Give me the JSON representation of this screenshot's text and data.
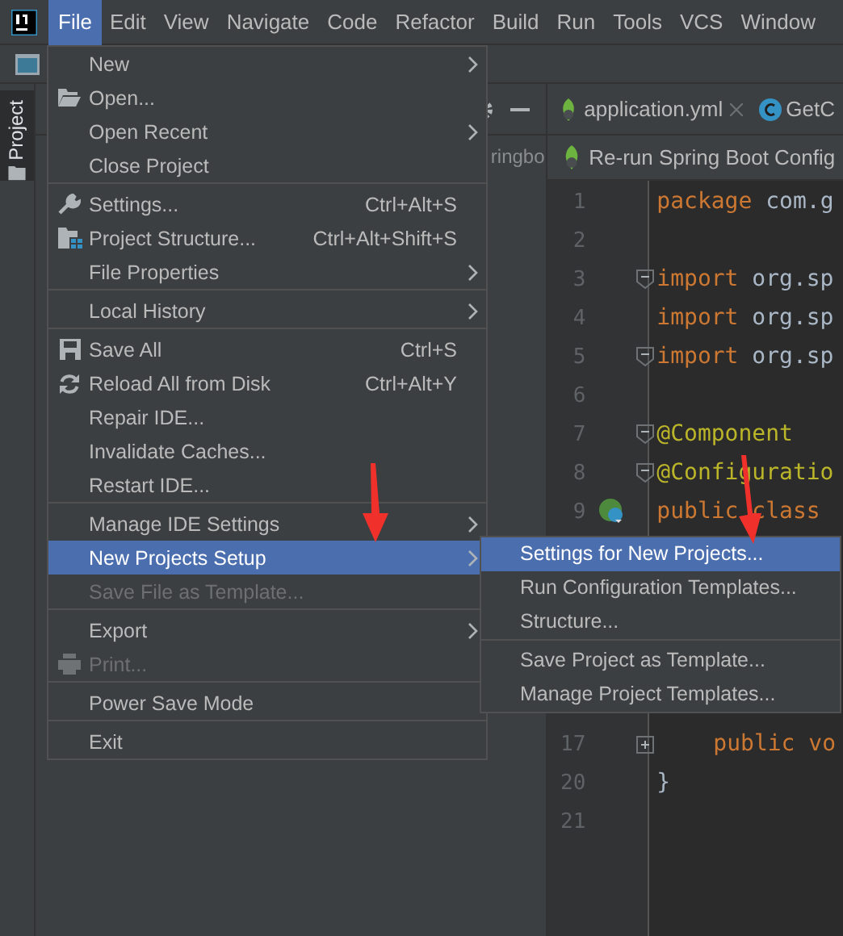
{
  "menubar": [
    {
      "label": "File",
      "selected": true
    },
    {
      "label": "Edit",
      "selected": false
    },
    {
      "label": "View",
      "selected": false
    },
    {
      "label": "Navigate",
      "selected": false
    },
    {
      "label": "Code",
      "selected": false
    },
    {
      "label": "Refactor",
      "selected": false
    },
    {
      "label": "Build",
      "selected": false
    },
    {
      "label": "Run",
      "selected": false
    },
    {
      "label": "Tools",
      "selected": false
    },
    {
      "label": "VCS",
      "selected": false
    },
    {
      "label": "Window",
      "selected": false
    }
  ],
  "tool_stripe": {
    "tab": {
      "label": "Project",
      "selected": true
    }
  },
  "project_panel": {
    "text": "ringbo"
  },
  "editor": {
    "tabs": [
      {
        "label": "application.yml",
        "kind": "yaml",
        "selected": true
      },
      {
        "label": "GetC",
        "kind": "class",
        "selected": false
      }
    ],
    "notification": "Re-run Spring Boot Config",
    "code_sections": [
      [
        {
          "number": "1",
          "indented": false,
          "tokens": [
            {
              "kind": "keyword",
              "text": "package"
            },
            {
              "kind": "plain",
              "text": " com.g"
            }
          ]
        },
        {
          "number": "2"
        },
        {
          "number": "3",
          "indented": false,
          "fold_marker": true,
          "collapsed": false,
          "tokens": [
            {
              "kind": "keyword",
              "text": "import"
            },
            {
              "kind": "plain",
              "text": " org.sp"
            }
          ]
        },
        {
          "number": "4",
          "indented": false,
          "tokens": [
            {
              "kind": "keyword",
              "text": "import"
            },
            {
              "kind": "plain",
              "text": " org.sp"
            }
          ]
        },
        {
          "number": "5",
          "indented": false,
          "fold_marker": true,
          "collapsed": false,
          "tokens": [
            {
              "kind": "keyword",
              "text": "import"
            },
            {
              "kind": "plain",
              "text": " org.sp"
            }
          ]
        },
        {
          "number": "6"
        },
        {
          "number": "7",
          "indented": false,
          "fold_marker": true,
          "collapsed": false,
          "tokens": [
            {
              "kind": "annotation",
              "text": "@Component"
            }
          ]
        },
        {
          "number": "8",
          "indented": false,
          "fold_marker": true,
          "collapsed": false,
          "tokens": [
            {
              "kind": "annotation",
              "text": "@Configuratio"
            }
          ]
        },
        {
          "number": "9",
          "indented": false,
          "bean_marker": true,
          "tokens": [
            {
              "kind": "keyword",
              "text": "public class"
            }
          ]
        }
      ],
      [
        {
          "number": "17",
          "indented": true,
          "fold_marker": true,
          "collapsed": true,
          "tokens": [
            {
              "kind": "keyword",
              "text": "public vo"
            }
          ]
        },
        {
          "number": "20",
          "indented": false,
          "tokens": [
            {
              "kind": "plain",
              "text": "}"
            }
          ]
        },
        {
          "number": "21"
        }
      ]
    ]
  },
  "file_menu": {
    "groups": [
      [
        {
          "label": "New",
          "submenu": true,
          "disabled": false,
          "selected": false
        },
        {
          "label": "Open...",
          "submenu": false,
          "disabled": false,
          "selected": false
        },
        {
          "label": "Open Recent",
          "submenu": true,
          "disabled": false,
          "selected": false
        },
        {
          "label": "Close Project",
          "submenu": false,
          "disabled": false,
          "selected": false
        }
      ],
      [
        {
          "label": "Settings...",
          "shortcut": "Ctrl+Alt+S",
          "submenu": false,
          "disabled": false,
          "selected": false
        },
        {
          "label": "Project Structure...",
          "shortcut": "Ctrl+Alt+Shift+S",
          "submenu": false,
          "disabled": false,
          "selected": false
        },
        {
          "label": "File Properties",
          "submenu": true,
          "disabled": false,
          "selected": false
        }
      ],
      [
        {
          "label": "Local History",
          "submenu": true,
          "disabled": false,
          "selected": false
        }
      ],
      [
        {
          "label": "Save All",
          "shortcut": "Ctrl+S",
          "submenu": false,
          "disabled": false,
          "selected": false
        },
        {
          "label": "Reload All from Disk",
          "shortcut": "Ctrl+Alt+Y",
          "submenu": false,
          "disabled": false,
          "selected": false
        },
        {
          "label": "Repair IDE...",
          "submenu": false,
          "disabled": false,
          "selected": false
        },
        {
          "label": "Invalidate Caches...",
          "submenu": false,
          "disabled": false,
          "selected": false
        },
        {
          "label": "Restart IDE...",
          "submenu": false,
          "disabled": false,
          "selected": false
        }
      ],
      [
        {
          "label": "Manage IDE Settings",
          "submenu": true,
          "disabled": false,
          "selected": false
        },
        {
          "label": "New Projects Setup",
          "submenu": true,
          "disabled": false,
          "selected": true
        },
        {
          "label": "Save File as Template...",
          "submenu": false,
          "disabled": true,
          "selected": false
        }
      ],
      [
        {
          "label": "Export",
          "submenu": true,
          "disabled": false,
          "selected": false
        },
        {
          "label": "Print...",
          "submenu": false,
          "disabled": true,
          "selected": false
        }
      ],
      [
        {
          "label": "Power Save Mode",
          "submenu": false,
          "disabled": false,
          "selected": false
        }
      ],
      [
        {
          "label": "Exit",
          "submenu": false,
          "disabled": false,
          "selected": false
        }
      ]
    ]
  },
  "submenu": {
    "groups": [
      [
        {
          "label": "Settings for New Projects...",
          "selected": true
        },
        {
          "label": "Run Configuration Templates...",
          "selected": false
        },
        {
          "label": "Structure...",
          "selected": false
        }
      ],
      [
        {
          "label": "Save Project as Template...",
          "selected": false
        },
        {
          "label": "Manage Project Templates...",
          "selected": false
        }
      ]
    ]
  }
}
